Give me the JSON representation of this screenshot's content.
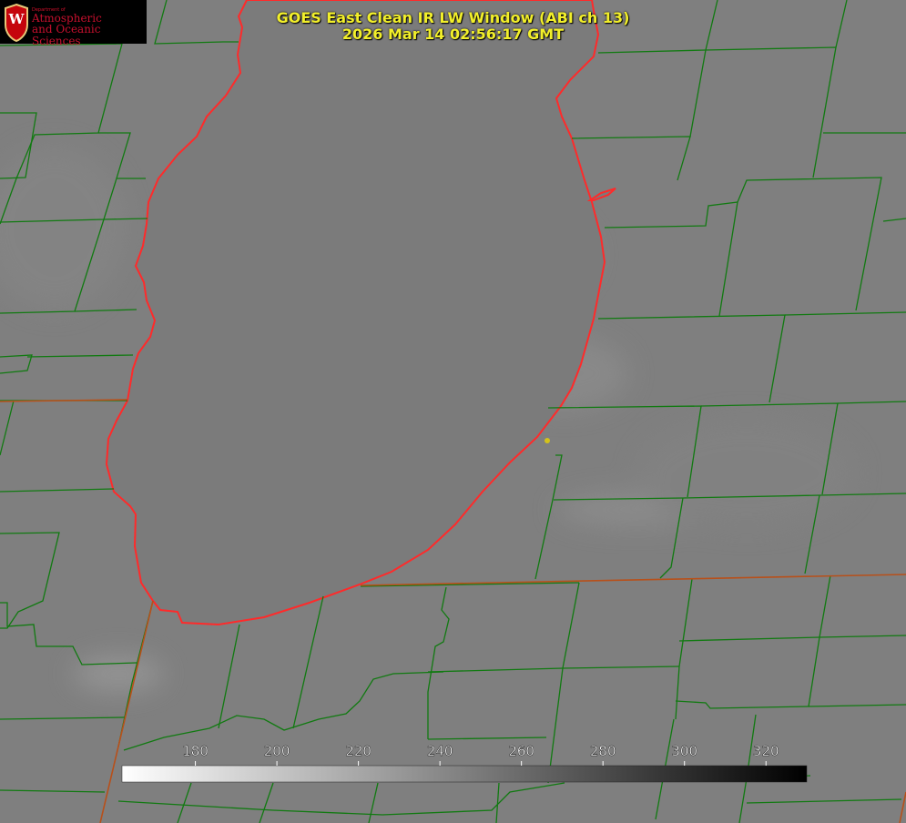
{
  "header": {
    "title_line1": "GOES East Clean IR LW Window (ABI ch 13)",
    "title_line2": "2026 Mar 14 02:56:17 GMT"
  },
  "logo": {
    "department": "Department of",
    "line1": "Atmospheric",
    "line2": "and Oceanic Sciences",
    "emblem_letter": "W"
  },
  "colorbar": {
    "ticks": [
      "180",
      "200",
      "220",
      "240",
      "260",
      "280",
      "300",
      "320"
    ],
    "range": [
      162,
      330
    ],
    "gradient": "white-to-black"
  },
  "map": {
    "lake_outline_color": "#ff2222",
    "county_line_color": "#0a7a0a",
    "state_line_color": "#c04010",
    "marker_color": "#d4c21a",
    "background_gray": "#7f7f7f",
    "lake_gray": "#7a7a7a"
  }
}
